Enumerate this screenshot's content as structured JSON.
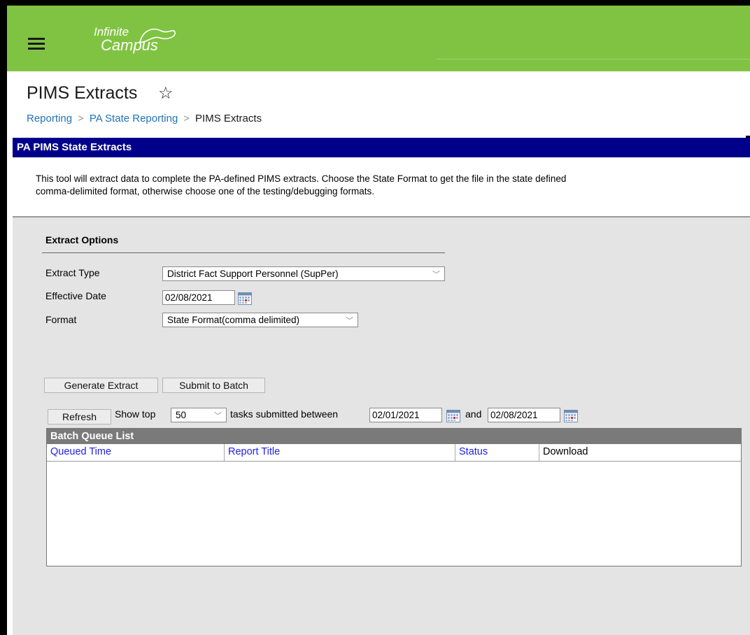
{
  "app": {
    "logo_line1": "Infinite",
    "logo_line2": "Campus"
  },
  "header": {
    "title": "PIMS Extracts",
    "breadcrumb": [
      "Reporting",
      "PA State Reporting",
      "PIMS Extracts"
    ]
  },
  "section": {
    "title": "PA PIMS State Extracts",
    "description_line1": "This tool will extract data to complete the PA-defined PIMS extracts. Choose the State Format to get the file in the state defined",
    "description_line2": "comma-delimited format, otherwise choose one of the testing/debugging formats."
  },
  "options": {
    "title": "Extract Options",
    "extract_type_label": "Extract Type",
    "extract_type_value": "District Fact Support Personnel (SupPer)",
    "effective_date_label": "Effective Date",
    "effective_date_value": "02/08/2021",
    "format_label": "Format",
    "format_value": "State Format(comma delimited)"
  },
  "actions": {
    "generate_label": "Generate Extract",
    "submit_label": "Submit to Batch"
  },
  "batch_filter": {
    "refresh_label": "Refresh",
    "show_top_label": "Show top",
    "show_top_value": "50",
    "between_label": "tasks submitted between",
    "from_date": "02/01/2021",
    "and_label": "and",
    "to_date": "02/08/2021"
  },
  "batch_queue": {
    "title": "Batch Queue List",
    "columns": [
      "Queued Time",
      "Report Title",
      "Status",
      "Download"
    ]
  },
  "colors": {
    "topbar": "#80c342",
    "section_bar": "#00008b",
    "link": "#1f72b8",
    "sortable_header": "#1f1fe6"
  }
}
